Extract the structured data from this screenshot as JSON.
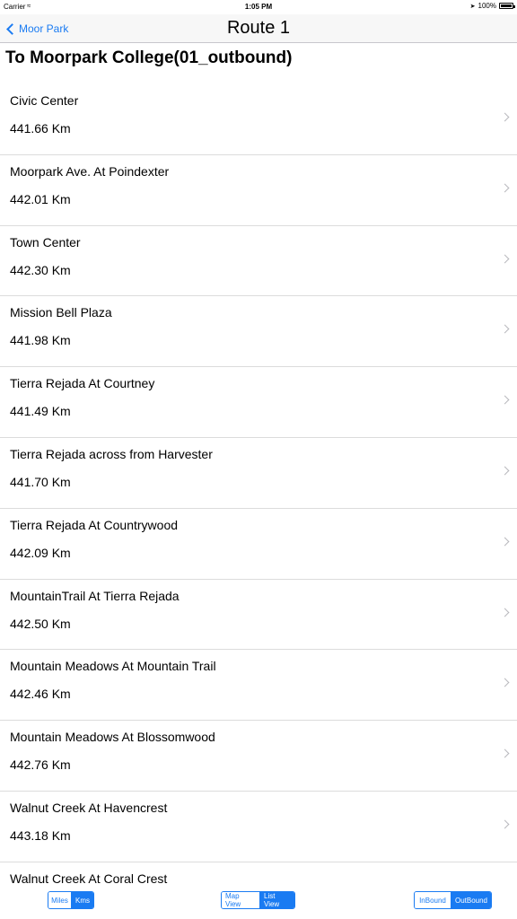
{
  "status_bar": {
    "carrier": "Carrier",
    "wifi_icon": "wifi-icon",
    "time": "1:05 PM",
    "battery_percent": "100%"
  },
  "nav": {
    "back_label": "Moor Park",
    "title": "Route 1"
  },
  "section_title": "To Moorpark College(01_outbound)",
  "stops": [
    {
      "name": "Civic Center",
      "distance": "441.66 Km"
    },
    {
      "name": "Moorpark Ave. At Poindexter",
      "distance": "442.01 Km"
    },
    {
      "name": "Town Center",
      "distance": "442.30 Km"
    },
    {
      "name": "Mission Bell Plaza",
      "distance": "441.98 Km"
    },
    {
      "name": "Tierra Rejada At Courtney",
      "distance": "441.49 Km"
    },
    {
      "name": "Tierra Rejada across from Harvester",
      "distance": "441.70 Km"
    },
    {
      "name": "Tierra Rejada At Countrywood",
      "distance": "442.09 Km"
    },
    {
      "name": "MountainTrail At Tierra Rejada",
      "distance": "442.50 Km"
    },
    {
      "name": "Mountain Meadows At Mountain Trail",
      "distance": "442.46 Km"
    },
    {
      "name": "Mountain Meadows At Blossomwood",
      "distance": "442.76 Km"
    },
    {
      "name": "Walnut Creek At Havencrest",
      "distance": "443.18 Km"
    },
    {
      "name": "Walnut Creek At Coral Crest",
      "distance": ""
    }
  ],
  "toolbar": {
    "units": {
      "miles": "Miles",
      "kms": "Kms",
      "selected": "Kms"
    },
    "view": {
      "map": "Map View",
      "list": "List View",
      "selected": "List View"
    },
    "bound": {
      "inbound": "InBound",
      "outbound": "OutBound",
      "selected": "OutBound"
    }
  },
  "colors": {
    "accent": "#1a7bf2",
    "separator": "#dcdcdc"
  }
}
